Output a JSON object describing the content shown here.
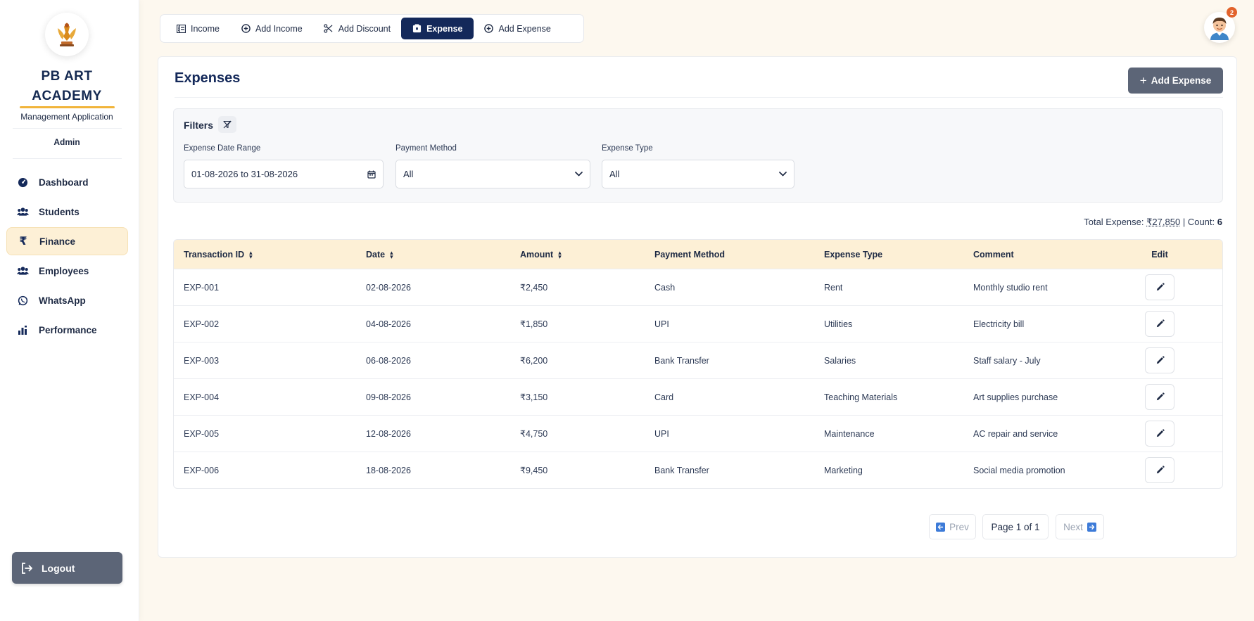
{
  "sidebar": {
    "brand_title": "PB ART ACADEMY",
    "brand_subtitle": "Management Application",
    "role": "Admin",
    "items": [
      {
        "label": "Dashboard",
        "icon": "dashboard-icon"
      },
      {
        "label": "Students",
        "icon": "users-icon"
      },
      {
        "label": "Finance",
        "icon": "rupee-icon",
        "active": true
      },
      {
        "label": "Employees",
        "icon": "users-icon"
      },
      {
        "label": "WhatsApp",
        "icon": "whatsapp-icon"
      },
      {
        "label": "Performance",
        "icon": "bar-chart-icon"
      }
    ],
    "logout_label": "Logout"
  },
  "tabs": [
    {
      "label": "Income",
      "icon": "ledger-icon"
    },
    {
      "label": "Add Income",
      "icon": "plus-circle-icon"
    },
    {
      "label": "Add Discount",
      "icon": "scissors-icon"
    },
    {
      "label": "Expense",
      "icon": "wallet-icon",
      "active": true
    },
    {
      "label": "Add Expense",
      "icon": "plus-circle-icon"
    }
  ],
  "header": {
    "notification_count": "2"
  },
  "page": {
    "title": "Expenses",
    "add_button_label": "Add Expense"
  },
  "filters": {
    "title": "Filters",
    "date_range_label": "Expense Date Range",
    "date_range_value": "01-08-2026 to 31-08-2026",
    "payment_method_label": "Payment Method",
    "payment_method_value": "All",
    "expense_type_label": "Expense Type",
    "expense_type_value": "All"
  },
  "summary": {
    "total_label": "Total Expense:",
    "total_value": "₹27,850",
    "separator": "|",
    "count_label": "Count:",
    "count_value": "6"
  },
  "table": {
    "columns": [
      "Transaction ID",
      "Date",
      "Amount",
      "Payment Method",
      "Expense Type",
      "Comment",
      "Edit"
    ],
    "rows": [
      {
        "id": "EXP-001",
        "date": "02-08-2026",
        "amount": "₹2,450",
        "method": "Cash",
        "type": "Rent",
        "comment": "Monthly studio rent"
      },
      {
        "id": "EXP-002",
        "date": "04-08-2026",
        "amount": "₹1,850",
        "method": "UPI",
        "type": "Utilities",
        "comment": "Electricity bill"
      },
      {
        "id": "EXP-003",
        "date": "06-08-2026",
        "amount": "₹6,200",
        "method": "Bank Transfer",
        "type": "Salaries",
        "comment": "Staff salary - July"
      },
      {
        "id": "EXP-004",
        "date": "09-08-2026",
        "amount": "₹3,150",
        "method": "Card",
        "type": "Teaching Materials",
        "comment": "Art supplies purchase"
      },
      {
        "id": "EXP-005",
        "date": "12-08-2026",
        "amount": "₹4,750",
        "method": "UPI",
        "type": "Maintenance",
        "comment": "AC repair and service"
      },
      {
        "id": "EXP-006",
        "date": "18-08-2026",
        "amount": "₹9,450",
        "method": "Bank Transfer",
        "type": "Marketing",
        "comment": "Social media promotion"
      }
    ]
  },
  "pagination": {
    "prev_label": "Prev",
    "page_label": "Page 1 of 1",
    "next_label": "Next"
  },
  "colors": {
    "primary": "#14295a",
    "accent": "#f1b43a",
    "active_bg": "#fdf0d6",
    "button_gray": "#5c6577"
  }
}
